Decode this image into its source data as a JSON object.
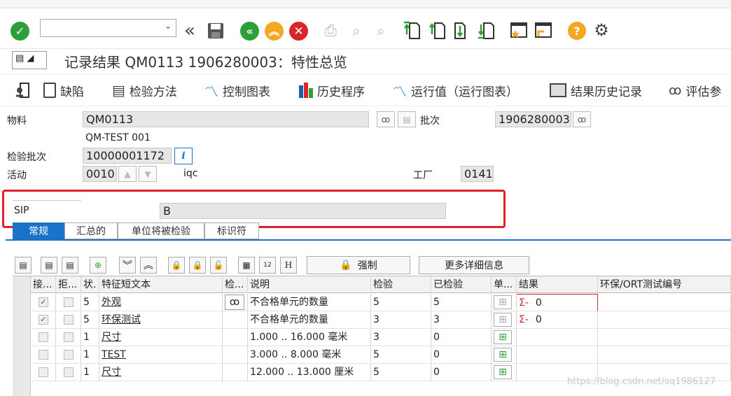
{
  "toolbar": {
    "command_field_value": "",
    "icons": [
      "enter-icon",
      "back-double-icon",
      "save-icon",
      "back-icon",
      "exit-icon",
      "cancel-icon",
      "print-icon",
      "find-icon",
      "find-next-icon",
      "first-page-icon",
      "previous-page-icon",
      "next-page-icon",
      "last-page-icon",
      "create-session-icon",
      "shortcut-icon",
      "help-icon",
      "settings-icon"
    ]
  },
  "title": "记录结果 QM0113 1906280003：特性总览",
  "app_toolbar": [
    {
      "label": "缺陷",
      "icon": "defect-icon"
    },
    {
      "label": "检验方法",
      "icon": "inspection-method-icon"
    },
    {
      "label": "控制图表",
      "icon": "control-chart-icon"
    },
    {
      "label": "历史程序",
      "icon": "history-icon"
    },
    {
      "label": "运行值（运行图表）",
      "icon": "run-chart-icon"
    },
    {
      "label": "结果历史记录",
      "icon": "result-history-icon"
    },
    {
      "label": "评估参",
      "icon": "evaluate-icon"
    }
  ],
  "header": {
    "material_label": "物料",
    "material_value": "QM0113",
    "material_desc": "QM-TEST 001",
    "batch_label": "批次",
    "batch_value": "1906280003",
    "lot_label": "检验批次",
    "lot_value": "10000001172",
    "activity_label": "活动",
    "activity_value": "0010",
    "activity_desc": "iqc",
    "plant_label": "工厂",
    "plant_value": "0141",
    "sip_label": "SIP",
    "sip_value": "B"
  },
  "tabs": [
    "常规",
    "汇总的",
    "单位将被检验",
    "标识符"
  ],
  "grid_buttons": {
    "force_label": "强制",
    "more_details_label": "更多详细信息"
  },
  "table": {
    "columns": [
      "接...",
      "拒...",
      "状.",
      "特征短文本",
      "检...",
      "说明",
      "检验",
      "已检验",
      "单...",
      "结果",
      "环保/ORT测试编号"
    ],
    "rows": [
      {
        "accept": "✓",
        "reject": "",
        "status": "5",
        "text": "外观",
        "desc": "不合格单元的数量",
        "inspect": "5",
        "inspected": "5",
        "result": "0",
        "result_prefix": "Σ-",
        "ort": ""
      },
      {
        "accept": "✓",
        "reject": "",
        "status": "5",
        "text": "环保测试",
        "desc": "不合格单元的数量",
        "inspect": "3",
        "inspected": "3",
        "result": "0",
        "result_prefix": "Σ-",
        "ort": ""
      },
      {
        "accept": "",
        "reject": "",
        "status": "1",
        "text": "尺寸",
        "desc": "1.000 .. 16.000 毫米",
        "inspect": "3",
        "inspected": "0",
        "result": "",
        "result_prefix": "",
        "ort": ""
      },
      {
        "accept": "",
        "reject": "",
        "status": "1",
        "text": "TEST",
        "desc": "3.000 .. 8.000 毫米",
        "inspect": "5",
        "inspected": "0",
        "result": "",
        "result_prefix": "",
        "ort": ""
      },
      {
        "accept": "",
        "reject": "",
        "status": "1",
        "text": "尺寸",
        "desc": "12.000 .. 13.000 厘米",
        "inspect": "5",
        "inspected": "0",
        "result": "",
        "result_prefix": "",
        "ort": ""
      }
    ]
  },
  "watermark": "https://blog.csdn.net/sq1986127",
  "colors": {
    "green": "#2e9e3a",
    "red": "#d9262b",
    "orange": "#f5a623",
    "tab_active": "#1a73c8",
    "highlight_box": "#e0202a"
  }
}
